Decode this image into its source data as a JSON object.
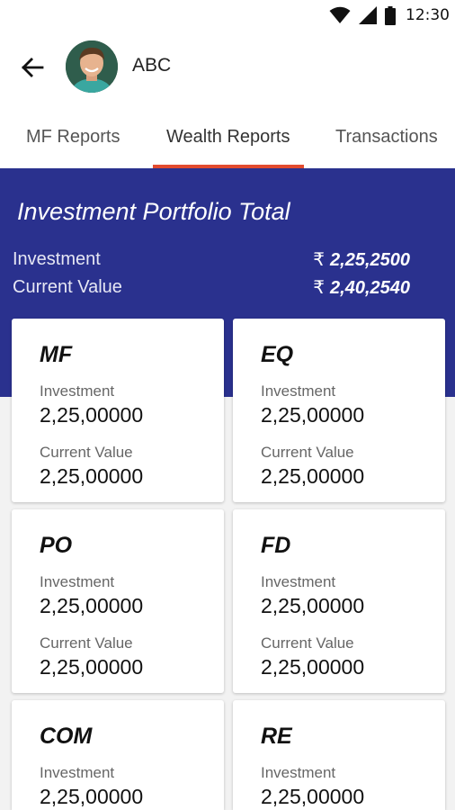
{
  "status_bar": {
    "time": "12:30",
    "icons": [
      "wifi-icon",
      "signal-icon",
      "battery-icon"
    ]
  },
  "header": {
    "back_icon": "arrow-left-icon",
    "user_name": "ABC"
  },
  "tabs": [
    {
      "label": "MF Reports",
      "active": false
    },
    {
      "label": "Wealth Reports",
      "active": true
    },
    {
      "label": "Transactions",
      "active": false
    }
  ],
  "portfolio": {
    "title": "Investment Portfolio Total",
    "investment_label": "Investment",
    "investment_value": "2,25,2500",
    "current_value_label": "Current Value",
    "current_value": "2,40,2540",
    "currency_symbol": "₹"
  },
  "cards": [
    {
      "name": "MF",
      "investment_label": "Investment",
      "investment": "2,25,00000",
      "current_label": "Current Value",
      "current": "2,25,00000"
    },
    {
      "name": "EQ",
      "investment_label": "Investment",
      "investment": "2,25,00000",
      "current_label": "Current Value",
      "current": "2,25,00000"
    },
    {
      "name": "PO",
      "investment_label": "Investment",
      "investment": "2,25,00000",
      "current_label": "Current Value",
      "current": "2,25,00000"
    },
    {
      "name": "FD",
      "investment_label": "Investment",
      "investment": "2,25,00000",
      "current_label": "Current Value",
      "current": "2,25,00000"
    },
    {
      "name": "COM",
      "investment_label": "Investment",
      "investment": "2,25,00000"
    },
    {
      "name": "RE",
      "investment_label": "Investment",
      "investment": "2,25,00000"
    }
  ],
  "colors": {
    "banner": "#2a318e",
    "tab_indicator": "#e24b2f",
    "background": "#f2f2f2"
  }
}
